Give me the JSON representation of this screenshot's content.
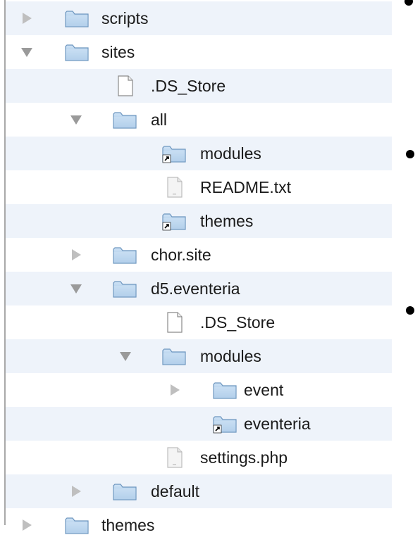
{
  "tree": [
    {
      "id": "scripts",
      "label": "scripts",
      "type": "folder",
      "depth": 0,
      "disclosure": "collapsed",
      "alias": false,
      "alt": true
    },
    {
      "id": "sites",
      "label": "sites",
      "type": "folder",
      "depth": 0,
      "disclosure": "expanded",
      "alias": false,
      "alt": false
    },
    {
      "id": "sites-ds-store",
      "label": ".DS_Store",
      "type": "file",
      "depth": 1,
      "disclosure": "none",
      "alias": false,
      "alt": true
    },
    {
      "id": "all",
      "label": "all",
      "type": "folder",
      "depth": 1,
      "disclosure": "expanded",
      "alias": false,
      "alt": false
    },
    {
      "id": "all-modules",
      "label": "modules",
      "type": "folder",
      "depth": 2,
      "disclosure": "none",
      "alias": true,
      "alt": true
    },
    {
      "id": "all-readme",
      "label": "README.txt",
      "type": "textfile",
      "depth": 2,
      "disclosure": "none",
      "alias": false,
      "alt": false
    },
    {
      "id": "all-themes",
      "label": "themes",
      "type": "folder",
      "depth": 2,
      "disclosure": "none",
      "alias": true,
      "alt": true
    },
    {
      "id": "chor-site",
      "label": "chor.site",
      "type": "folder",
      "depth": 1,
      "disclosure": "collapsed",
      "alias": false,
      "alt": false
    },
    {
      "id": "d5-eventeria",
      "label": "d5.eventeria",
      "type": "folder",
      "depth": 1,
      "disclosure": "expanded",
      "alias": false,
      "alt": true
    },
    {
      "id": "d5-ds-store",
      "label": ".DS_Store",
      "type": "file",
      "depth": 2,
      "disclosure": "none",
      "alias": false,
      "alt": false
    },
    {
      "id": "d5-modules",
      "label": "modules",
      "type": "folder",
      "depth": 2,
      "disclosure": "expanded",
      "alias": false,
      "alt": true
    },
    {
      "id": "event",
      "label": "event",
      "type": "folder",
      "depth": 3,
      "disclosure": "collapsed",
      "alias": false,
      "alt": false
    },
    {
      "id": "eventeria",
      "label": "eventeria",
      "type": "folder",
      "depth": 3,
      "disclosure": "none",
      "alias": true,
      "alt": true
    },
    {
      "id": "settings-php",
      "label": "settings.php",
      "type": "textfile",
      "depth": 2,
      "disclosure": "none",
      "alias": false,
      "alt": false
    },
    {
      "id": "default",
      "label": "default",
      "type": "folder",
      "depth": 1,
      "disclosure": "collapsed",
      "alias": false,
      "alt": true
    },
    {
      "id": "themes",
      "label": "themes",
      "type": "folder",
      "depth": 0,
      "disclosure": "collapsed",
      "alias": false,
      "alt": false
    }
  ],
  "colors": {
    "folder_top": "#cfe3f6",
    "folder_bottom": "#8fb6dc",
    "folder_edge": "#6d96bf",
    "row_alt": "#eef3fa",
    "disclosure": "#bfbfbf"
  }
}
